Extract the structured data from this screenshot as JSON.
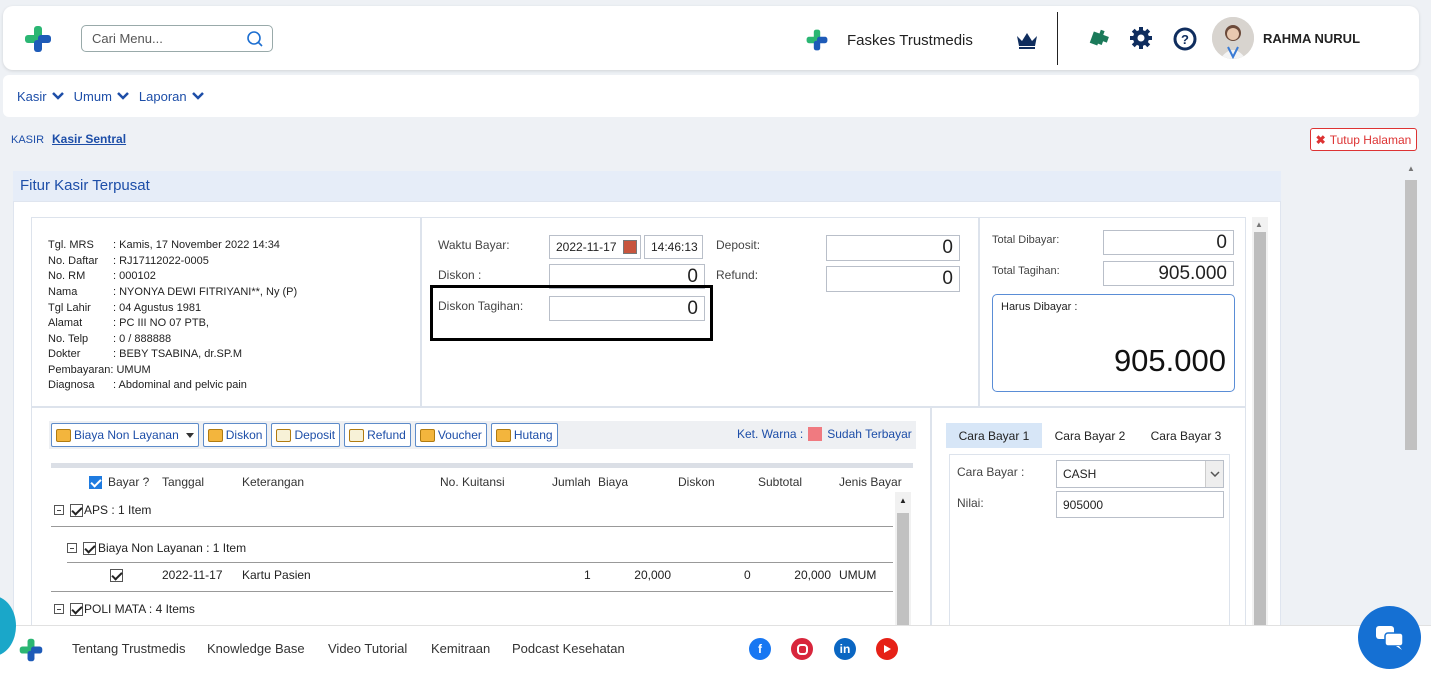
{
  "header": {
    "search_placeholder": "Cari Menu...",
    "faskes_label": "Faskes Trustmedis",
    "user_name": "RAHMA NURUL"
  },
  "menu": {
    "items": [
      {
        "label": "Kasir"
      },
      {
        "label": "Umum"
      },
      {
        "label": "Laporan"
      }
    ]
  },
  "breadcrumb": {
    "root": "KASIR",
    "current": "Kasir Sentral"
  },
  "close_button": "Tutup Halaman",
  "panel_title": "Fitur Kasir Terpusat",
  "patient": [
    {
      "label": "Tgl. MRS",
      "value": ": Kamis, 17 November 2022 14:34"
    },
    {
      "label": "No. Daftar",
      "value": ": RJ17112022-0005"
    },
    {
      "label": "No. RM",
      "value": ": 000102"
    },
    {
      "label": "Nama",
      "value": ": NYONYA DEWI FITRIYANI**, Ny (P)"
    },
    {
      "label": "Tgl Lahir",
      "value": ": 04 Agustus 1981"
    },
    {
      "label": "Alamat",
      "value": ": PC III NO 07 PTB,"
    },
    {
      "label": "No. Telp",
      "value": ": 0 / 888888"
    },
    {
      "label": "Dokter",
      "value": ": BEBY TSABINA, dr.SP.M"
    },
    {
      "label": "Pembayaran",
      "value": ": UMUM"
    },
    {
      "label": "Diagnosa",
      "value": ": Abdominal and pelvic pain"
    }
  ],
  "payment_form": {
    "waktu_bayar_label": "Waktu Bayar:",
    "date": "2022-11-17",
    "time": "14:46:13",
    "diskon_label": "Diskon :",
    "diskon_value": "0",
    "diskon_tagihan_label": "Diskon Tagihan:",
    "diskon_tagihan_value": "0",
    "deposit_label": "Deposit:",
    "deposit_value": "0",
    "refund_label": "Refund:",
    "refund_value": "0"
  },
  "totals": {
    "total_dibayar_label": "Total Dibayar:",
    "total_dibayar_value": "0",
    "total_tagihan_label": "Total Tagihan:",
    "total_tagihan_value": "905.000",
    "harus_dibayar_label": "Harus Dibayar :",
    "harus_dibayar_value": "905.000"
  },
  "toolbar": {
    "biaya_non_layanan": "Biaya Non Layanan",
    "diskon": "Diskon",
    "deposit": "Deposit",
    "refund": "Refund",
    "voucher": "Voucher",
    "hutang": "Hutang",
    "legend_label": "Ket. Warna :",
    "legend_item": "Sudah Terbayar",
    "legend_color": "#f07a80"
  },
  "table": {
    "headers": {
      "bayar": "Bayar ?",
      "tanggal": "Tanggal",
      "keterangan": "Keterangan",
      "no_kuitansi": "No. Kuitansi",
      "jumlah": "Jumlah",
      "biaya": "Biaya",
      "diskon": "Diskon",
      "subtotal": "Subtotal",
      "jenis_bayar": "Jenis Bayar"
    },
    "group_aps": "APS : 1 Item",
    "group_bnl": "Biaya Non Layanan : 1 Item",
    "row": {
      "tanggal": "2022-11-17",
      "keterangan": "Kartu Pasien",
      "jumlah": "1",
      "biaya": "20,000",
      "diskon": "0",
      "subtotal": "20,000",
      "jenis_bayar": "UMUM"
    },
    "group_poli": "POLI MATA : 4 Items"
  },
  "cara_bayar": {
    "tabs": [
      "Cara Bayar 1",
      "Cara Bayar 2",
      "Cara Bayar 3"
    ],
    "cara_bayar_label": "Cara Bayar :",
    "cara_bayar_value": "CASH",
    "nilai_label": "Nilai:",
    "nilai_value": "905000"
  },
  "footer": {
    "links": [
      "Tentang Trustmedis",
      "Knowledge Base",
      "Video Tutorial",
      "Kemitraan",
      "Podcast Kesehatan"
    ]
  },
  "colors": {
    "brand_blue": "#1d4ea8",
    "logo_green": "#2bb673",
    "logo_blue": "#1e5bb8"
  }
}
